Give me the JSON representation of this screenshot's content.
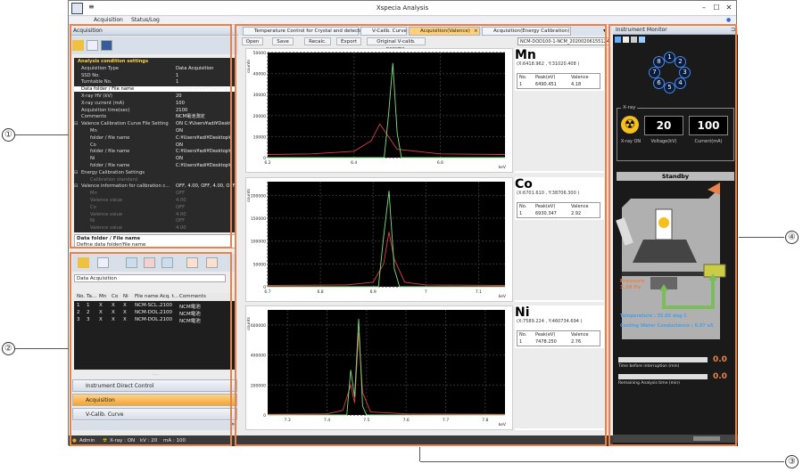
{
  "app": {
    "title": "Xspecia Analysis"
  },
  "menu": [
    "Acquisition",
    "Status/Log"
  ],
  "left_panel": {
    "header": "Acquisition",
    "tree": [
      {
        "k": "Analysis condition settings",
        "v": "",
        "type": "grp"
      },
      {
        "k": "Acquisition Type",
        "v": "Data Acquisition",
        "type": "row"
      },
      {
        "k": "SSD No.",
        "v": "1",
        "type": "row"
      },
      {
        "k": "Turntable No.",
        "v": "1",
        "type": "row"
      },
      {
        "k": "Data folder / File name",
        "v": "C:¥Users¥adi¥Desktop¥",
        "type": "sel"
      },
      {
        "k": "X-ray HV (kV)",
        "v": "20",
        "type": "row"
      },
      {
        "k": "X-ray current (mA)",
        "v": "100",
        "type": "row"
      },
      {
        "k": "Acquisition time(sec)",
        "v": "2100",
        "type": "row"
      },
      {
        "k": "Comments",
        "v": "NCM電池測定",
        "type": "row"
      },
      {
        "k": "Valence Calibration Curve File Setting",
        "v": "ON C:¥Users¥adi¥Deskt",
        "type": "sub"
      },
      {
        "k": "Mn",
        "v": "ON",
        "type": "row2"
      },
      {
        "k": "folder / file name",
        "v": "C:¥Users¥adi¥Desktop¥",
        "type": "row2"
      },
      {
        "k": "Co",
        "v": "ON",
        "type": "row2"
      },
      {
        "k": "folder / file name",
        "v": "C:¥Users¥adi¥Desktop¥",
        "type": "row2"
      },
      {
        "k": "Ni",
        "v": "ON",
        "type": "row2"
      },
      {
        "k": "folder / file name",
        "v": "C:¥Users¥adi¥Desktop¥",
        "type": "row2"
      },
      {
        "k": "Energy Calibration Settings",
        "v": "",
        "type": "sub"
      },
      {
        "k": "Calibration standard",
        "v": "",
        "type": "dim2"
      },
      {
        "k": "Valence information for calibration c...",
        "v": "OFF, 4.00, OFF, 4.00, OFF",
        "type": "sub"
      },
      {
        "k": "Mn",
        "v": "OFF",
        "type": "dim2"
      },
      {
        "k": "Valence value",
        "v": "4.00",
        "type": "dim2"
      },
      {
        "k": "Co",
        "v": "OFF",
        "type": "dim2"
      },
      {
        "k": "Valence value",
        "v": "4.00",
        "type": "dim2"
      },
      {
        "k": "Ni",
        "v": "OFF",
        "type": "dim2"
      },
      {
        "k": "Valence value",
        "v": "4.00",
        "type": "dim2"
      }
    ],
    "help_title": "Data folder / File name",
    "help_text": "Define data folder/file name",
    "list_label": "Data Acquisition",
    "list_columns": [
      "No.",
      "Ta...",
      "Mn",
      "Co",
      "Ni",
      "File name",
      "Acq. t...",
      "Comments"
    ],
    "list_rows": [
      [
        "1",
        "1",
        "X",
        "X",
        "X",
        "NCM-SCL...",
        "2100",
        "NCM電池"
      ],
      [
        "2",
        "2",
        "X",
        "X",
        "X",
        "NCM-DOL...",
        "2100",
        "NCM電池"
      ],
      [
        "3",
        "3",
        "X",
        "X",
        "X",
        "NCM-DOL...",
        "2100",
        "NCM電池"
      ]
    ],
    "nav": [
      "Instrument Direct Control",
      "Acquisition",
      "V-Calib. Curve"
    ],
    "status": {
      "user": "Admin",
      "xray": "X-ray : ON",
      "kv": "kV : 20",
      "ma": "mA : 100"
    }
  },
  "center": {
    "tabs": [
      "Temperature Control for Crystal and detector",
      "V-Calib. Curve",
      "Acquisition(Valence)",
      "Acquisition(Energy Calibration)"
    ],
    "buttons": [
      "Open",
      "Save",
      "Recalc.",
      "Export",
      "Original V-calib. params."
    ],
    "file_field": "NCM-DOD100-1-NCM_20200206155124",
    "plots": [
      {
        "element": "Mn",
        "coord": "(X:6418.962 , Y:31020.408 )",
        "peak": "6490.451",
        "valence": "4.18"
      },
      {
        "element": "Co",
        "coord": "(X:6701.610 , Y:38706.300 )",
        "peak": "6930.347",
        "valence": "2.92"
      },
      {
        "element": "Ni",
        "coord": "(X:7589.224 , Y:460734.694 )",
        "peak": "7478.250",
        "valence": "2.76"
      }
    ],
    "result_cols": [
      "No.",
      "Peak(eV)",
      "Valence"
    ],
    "result_no": "1",
    "xunit": "keV",
    "yunit": "counts"
  },
  "chart_data": [
    {
      "type": "line",
      "title": "Mn",
      "xlabel": "keV",
      "ylabel": "counts",
      "xlim": [
        6.2,
        6.75
      ],
      "ylim": [
        0,
        50000
      ],
      "xticks": [
        "6.2",
        "6.4",
        "6.6"
      ],
      "yticks": [
        "0",
        "10000",
        "20000",
        "30000",
        "40000",
        "50000"
      ],
      "series": [
        {
          "color": "#e04040",
          "values": [
            [
              6.2,
              1500
            ],
            [
              6.3,
              1800
            ],
            [
              6.4,
              3000
            ],
            [
              6.44,
              8000
            ],
            [
              6.46,
              16000
            ],
            [
              6.48,
              10000
            ],
            [
              6.5,
              4000
            ],
            [
              6.6,
              1800
            ],
            [
              6.75,
              1500
            ]
          ]
        },
        {
          "color": "#7fe07f",
          "values": [
            [
              6.2,
              0
            ],
            [
              6.47,
              0
            ],
            [
              6.48,
              20000
            ],
            [
              6.49,
              45000
            ],
            [
              6.5,
              12000
            ],
            [
              6.51,
              0
            ],
            [
              6.75,
              0
            ]
          ]
        }
      ]
    },
    {
      "type": "line",
      "title": "Co",
      "xlabel": "keV",
      "ylabel": "counts",
      "xlim": [
        6.7,
        7.15
      ],
      "ylim": [
        0,
        230000
      ],
      "xticks": [
        "6.7",
        "6.8",
        "6.9",
        "7",
        "7.1"
      ],
      "yticks": [
        "0",
        "50000",
        "100000",
        "150000",
        "200000"
      ],
      "series": [
        {
          "color": "#e04040",
          "values": [
            [
              6.7,
              3000
            ],
            [
              6.85,
              4000
            ],
            [
              6.9,
              10000
            ],
            [
              6.92,
              50000
            ],
            [
              6.93,
              120000
            ],
            [
              6.94,
              60000
            ],
            [
              6.96,
              10000
            ],
            [
              7.0,
              4000
            ],
            [
              7.15,
              3000
            ]
          ]
        },
        {
          "color": "#7fe07f",
          "values": [
            [
              6.7,
              0
            ],
            [
              6.91,
              0
            ],
            [
              6.92,
              110000
            ],
            [
              6.93,
              210000
            ],
            [
              6.94,
              40000
            ],
            [
              6.95,
              0
            ],
            [
              7.15,
              0
            ]
          ]
        }
      ]
    },
    {
      "type": "line",
      "title": "Ni",
      "xlabel": "keV",
      "ylabel": "counts",
      "xlim": [
        7.25,
        7.85
      ],
      "ylim": [
        0,
        700000
      ],
      "xticks": [
        "7.3",
        "7.4",
        "7.5",
        "7.6",
        "7.7",
        "7.8"
      ],
      "yticks": [
        "0",
        "200000",
        "400000",
        "600000"
      ],
      "series": [
        {
          "color": "#e04040",
          "values": [
            [
              7.25,
              5000
            ],
            [
              7.4,
              8000
            ],
            [
              7.44,
              30000
            ],
            [
              7.46,
              200000
            ],
            [
              7.47,
              80000
            ],
            [
              7.48,
              550000
            ],
            [
              7.49,
              150000
            ],
            [
              7.51,
              20000
            ],
            [
              7.6,
              8000
            ],
            [
              7.85,
              5000
            ]
          ]
        },
        {
          "color": "#7fe07f",
          "values": [
            [
              7.25,
              0
            ],
            [
              7.45,
              0
            ],
            [
              7.46,
              300000
            ],
            [
              7.47,
              120000
            ],
            [
              7.48,
              640000
            ],
            [
              7.49,
              60000
            ],
            [
              7.5,
              0
            ],
            [
              7.85,
              0
            ]
          ]
        }
      ]
    }
  ],
  "monitor": {
    "header": "Instrument Monitor",
    "turret": [
      "1",
      "2",
      "3",
      "4",
      "5",
      "6",
      "7",
      "8"
    ],
    "xray_label": "X-ray",
    "xray_on": "X-ray ON",
    "voltage": "20",
    "voltage_label": "Voltage(kV)",
    "current": "100",
    "current_label": "Current(mA)",
    "state": "Standby",
    "pressure_label": "Pressure",
    "pressure_value": "3.38 Pa",
    "temperature": "Temperature : 35.05 deg C",
    "cooling": "Cooling Water Conductance : 0.07 uS",
    "time_interrupt_label": "Time before interruption (min)",
    "time_interrupt": "0.0",
    "remaining_label": "Remaining Analysis time (min)",
    "remaining": "0.0"
  },
  "callouts": [
    "①",
    "②",
    "③",
    "④"
  ]
}
